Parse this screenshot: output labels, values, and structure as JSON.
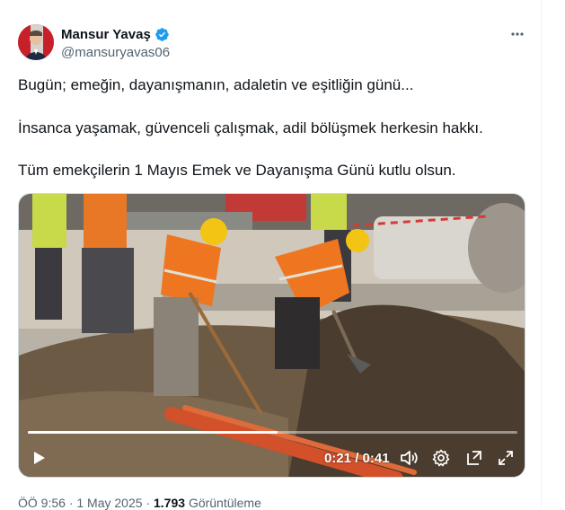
{
  "author": {
    "name": "Mansur Yavaş",
    "handle": "@mansuryavas06",
    "verified_icon": "verified-badge-icon",
    "badge_color": "#1d9bf0"
  },
  "more_icon": "more-horizontal-icon",
  "post": {
    "line1": "Bugün; emeğin, dayanışmanın, adaletin ve eşitliğin günü...",
    "line2": "İnsanca yaşamak, güvenceli çalışmak, adil bölüşmek herkesin hakkı.",
    "line3": "Tüm emekçilerin 1 Mayıs Emek ve Dayanışma Günü kutlu olsun."
  },
  "video": {
    "time": "0:21 / 0:41",
    "progress": 0.51,
    "play_icon": "play-icon",
    "volume_icon": "volume-icon",
    "settings_icon": "gear-icon",
    "popout_icon": "popout-icon",
    "fullscreen_icon": "fullscreen-icon"
  },
  "meta": {
    "time": "ÖÖ 9:56",
    "sep": "·",
    "date": "1 May 2025",
    "views_count": "1.793",
    "views_label": "Görüntüleme"
  }
}
